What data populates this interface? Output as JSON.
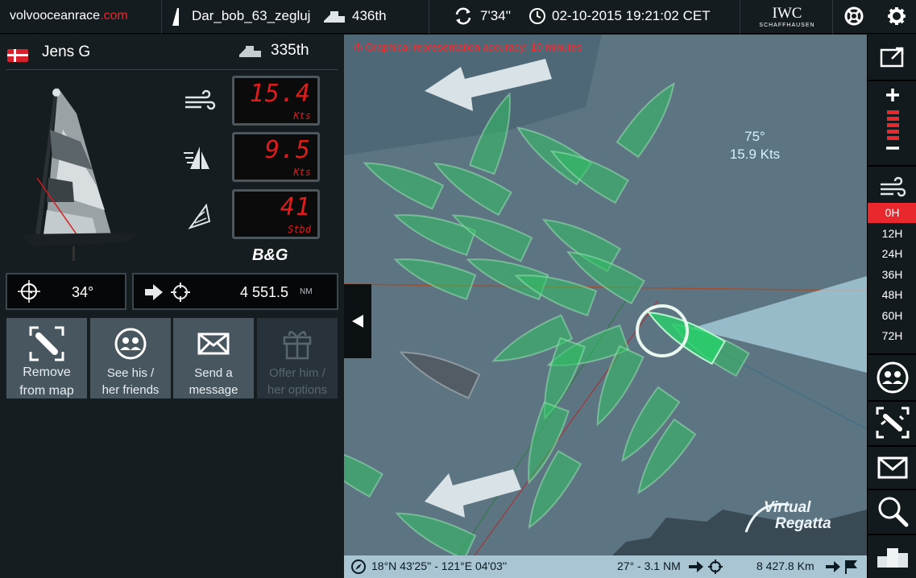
{
  "topbar": {
    "brand_main": "volvooceanrace",
    "brand_dot": ".com",
    "boat_name": "Dar_bob_63_zegluj",
    "rank": "436th",
    "refresh": "7'34''",
    "datetime": "02-10-2015 19:21:02 CET",
    "sponsor": "IWC",
    "sponsor_sub": "SCHAFFHAUSEN"
  },
  "player": {
    "name": "Jens G",
    "rank": "335th",
    "instruments": [
      {
        "value": "15.4",
        "unit": "Kts",
        "icon": "wind-icon"
      },
      {
        "value": "9.5",
        "unit": "Kts",
        "icon": "boat-speed-icon"
      },
      {
        "value": "41",
        "unit": "Stbd",
        "icon": "sail-angle-icon"
      }
    ],
    "instrument_brand": "B&G",
    "heading": "34°",
    "distance": "4 551.5",
    "distance_unit": "NM"
  },
  "actions": [
    {
      "label_1": "Remove",
      "label_2": "from map"
    },
    {
      "label_1": "See his /",
      "label_2": "her friends"
    },
    {
      "label_1": "Send a",
      "label_2": "message"
    },
    {
      "label_1": "Offer him /",
      "label_2": "her options"
    }
  ],
  "map": {
    "warning": "/!\\ Graphical representation accuracy: 10 minutes",
    "wind_angle": "75°",
    "wind_speed": "15.9 Kts",
    "watermark_1": "Virtual",
    "watermark_2": "Regatta"
  },
  "status": {
    "coords": "18°N 43'25'' - 121°E 04'03''",
    "bearing": "27° - 3.1 NM",
    "remaining": "8 427.8 Km"
  },
  "timeline": [
    "0H",
    "12H",
    "24H",
    "36H",
    "48H",
    "60H",
    "72H"
  ],
  "colors": {
    "accent": "#e8282d",
    "boat_green": "#22c25e",
    "sea": "#5f7784"
  }
}
